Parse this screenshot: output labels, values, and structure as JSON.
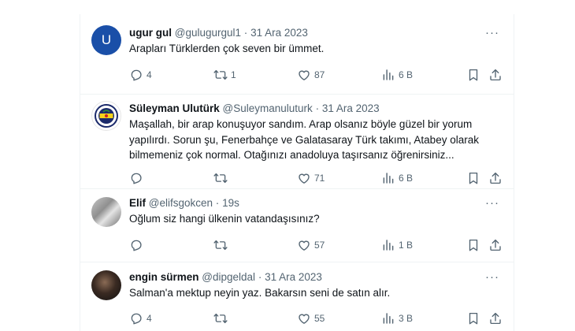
{
  "tweets": [
    {
      "avatar_letter": "U",
      "name": "ugur gul",
      "handle": "@gulugurgul1",
      "time": "31 Ara 2023",
      "text": "Arapları Türklerden çok seven bir ümmet.",
      "replies": "4",
      "retweets": "1",
      "likes": "87",
      "views": "6 B"
    },
    {
      "avatar_letter": "",
      "name": "Süleyman Ulutürk",
      "handle": "@Suleymanuluturk",
      "time": "31 Ara 2023",
      "text": "Maşallah, bir arap konuşuyor sandım. Arap olsanız böyle güzel bir yorum yapılırdı. Sorun şu, Fenerbahçe ve Galatasaray Türk takımı, Atabey olarak bilmemeniz çok normal. Otağınızı anadoluya taşırsanız öğrenirsiniz...",
      "replies": "",
      "retweets": "",
      "likes": "71",
      "views": "6 B"
    },
    {
      "avatar_letter": "",
      "name": "Elif",
      "handle": "@elifsgokcen",
      "time": "19s",
      "text": "Oğlum siz hangi ülkenin vatandaşısınız?",
      "replies": "",
      "retweets": "",
      "likes": "57",
      "views": "1 B"
    },
    {
      "avatar_letter": "",
      "name": "engin sürmen",
      "handle": "@dipgeldal",
      "time": "31 Ara 2023",
      "text": "Salman'a mektup neyin yaz. Bakarsın seni de satın alır.",
      "replies": "4",
      "retweets": "",
      "likes": "55",
      "views": "3 B"
    }
  ],
  "separator": "·",
  "more_glyph": "···",
  "colors": {
    "text": "#0f1419",
    "muted": "#536471",
    "divider": "#eff3f4",
    "avatar_blue": "#1a4fa8"
  },
  "icons": [
    "reply-icon",
    "retweet-icon",
    "like-icon",
    "views-icon",
    "bookmark-icon",
    "share-icon",
    "more-icon"
  ]
}
